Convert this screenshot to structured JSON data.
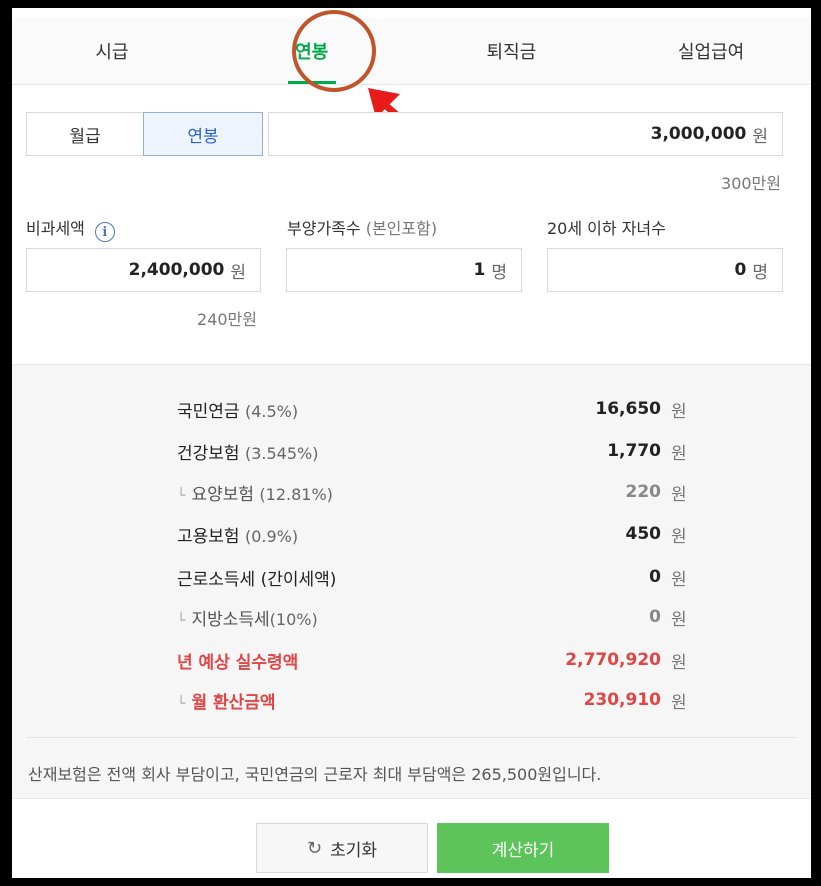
{
  "tabs": [
    {
      "label": "시급"
    },
    {
      "label": "연봉"
    },
    {
      "label": "퇴직금"
    },
    {
      "label": "실업급여"
    }
  ],
  "pay_type": {
    "monthly": "월급",
    "annual": "연봉"
  },
  "salary": {
    "value": "3,000,000",
    "unit": "원",
    "hint": "300만원"
  },
  "non_taxable": {
    "label": "비과세액",
    "value": "2,400,000",
    "unit": "원",
    "hint": "240만원",
    "info_icon": "i"
  },
  "dependents": {
    "label": "부양가족수",
    "sub": "(본인포함)",
    "value": "1",
    "unit": "명"
  },
  "children": {
    "label": "20세 이하 자녀수",
    "value": "0",
    "unit": "명"
  },
  "results": [
    {
      "name": "국민연금",
      "sub": "(4.5%)",
      "amount": "16,650",
      "unit": "원"
    },
    {
      "name": "건강보험",
      "sub": "(3.545%)",
      "amount": "1,770",
      "unit": "원"
    },
    {
      "prefix": "└",
      "name": "요양보험",
      "sub": "(12.81%)",
      "amount": "220",
      "unit": "원"
    },
    {
      "name": "고용보험",
      "sub": "(0.9%)",
      "amount": "450",
      "unit": "원"
    },
    {
      "name": "근로소득세 (간이세액)",
      "sub": "",
      "amount": "0",
      "unit": "원"
    },
    {
      "prefix": "└",
      "name": "지방소득세",
      "sub": "(10%)",
      "amount": "0",
      "unit": "원"
    },
    {
      "name": "년 예상 실수령액",
      "sub": "",
      "amount": "2,770,920",
      "unit": "원"
    },
    {
      "prefix": "└",
      "name": "월 환산금액",
      "sub": "",
      "amount": "230,910",
      "unit": "원"
    }
  ],
  "note": "산재보험은 전액 회사 부담이고, 국민연금의 근로자 최대 부담액은 265,500원입니다.",
  "buttons": {
    "reset": "초기화",
    "reset_icon": "↻",
    "calc": "계산하기"
  },
  "colors": {
    "accent_green": "#03a94d",
    "button_green": "#5dc35b",
    "highlight_red": "#e04646",
    "annotation": "#c0542b"
  }
}
